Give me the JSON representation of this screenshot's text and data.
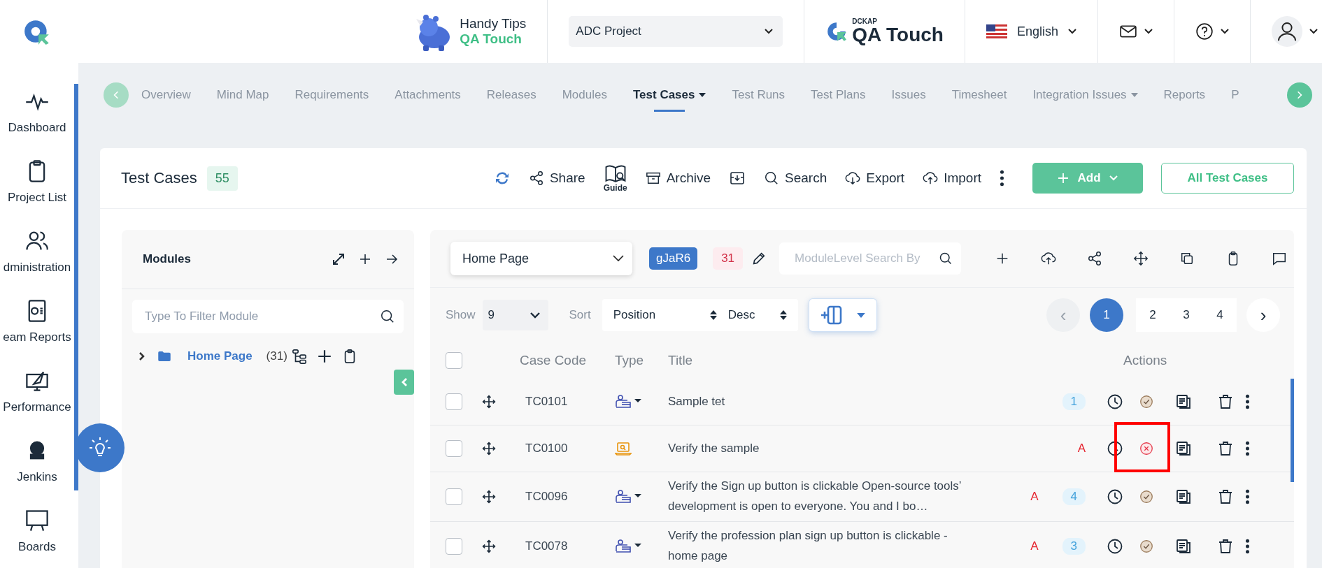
{
  "header": {
    "mascot_title": "Handy Tips",
    "mascot_subtitle": "QA Touch",
    "project": "ADC Project",
    "brand_small": "DCKAP",
    "brand": "QA Touch",
    "language": "English"
  },
  "sidebar": {
    "items": [
      {
        "label": "Dashboard"
      },
      {
        "label": "Project List"
      },
      {
        "label": "dministration"
      },
      {
        "label": "eam Reports"
      },
      {
        "label": "Performance"
      },
      {
        "label": "Jenkins"
      },
      {
        "label": "Boards"
      }
    ]
  },
  "nav_tabs": [
    {
      "label": "Overview",
      "selected": false,
      "dropdown": false
    },
    {
      "label": "Mind Map",
      "selected": false,
      "dropdown": false
    },
    {
      "label": "Requirements",
      "selected": false,
      "dropdown": false
    },
    {
      "label": "Attachments",
      "selected": false,
      "dropdown": false
    },
    {
      "label": "Releases",
      "selected": false,
      "dropdown": false
    },
    {
      "label": "Modules",
      "selected": false,
      "dropdown": false
    },
    {
      "label": "Test Cases",
      "selected": true,
      "dropdown": true
    },
    {
      "label": "Test Runs",
      "selected": false,
      "dropdown": false
    },
    {
      "label": "Test Plans",
      "selected": false,
      "dropdown": false
    },
    {
      "label": "Issues",
      "selected": false,
      "dropdown": false
    },
    {
      "label": "Timesheet",
      "selected": false,
      "dropdown": false
    },
    {
      "label": "Integration Issues",
      "selected": false,
      "dropdown": true
    },
    {
      "label": "Reports",
      "selected": false,
      "dropdown": false
    },
    {
      "label": "P",
      "selected": false,
      "dropdown": false
    }
  ],
  "page": {
    "title": "Test Cases",
    "count": "55",
    "toolbar": [
      {
        "kind": "refresh"
      },
      {
        "kind": "share",
        "label": "Share"
      },
      {
        "kind": "guide",
        "label": "Guide"
      },
      {
        "kind": "archive",
        "label": "Archive"
      },
      {
        "kind": "tray"
      },
      {
        "kind": "search",
        "label": "Search"
      },
      {
        "kind": "export",
        "label": "Export"
      },
      {
        "kind": "import",
        "label": "Import"
      },
      {
        "kind": "more"
      }
    ],
    "add_button": "Add",
    "all_button": "All Test Cases"
  },
  "modules": {
    "title": "Modules",
    "filter_placeholder": "Type To Filter Module",
    "tree": [
      {
        "label": "Home Page",
        "count": "(31)",
        "expanded": false
      }
    ]
  },
  "cases": {
    "module": "Home Page",
    "module_code": "gJaR6",
    "module_count": "31",
    "search_placeholder": "ModuleLevel Search By",
    "show_label": "Show",
    "show_value": "9",
    "sort_label": "Sort",
    "sort_field": "Position",
    "sort_order": "Desc",
    "pages": [
      {
        "label": "1",
        "selected": true
      },
      {
        "label": "2",
        "selected": false
      },
      {
        "label": "3",
        "selected": false
      },
      {
        "label": "4",
        "selected": false
      }
    ],
    "prev": "‹",
    "next": "›",
    "columns": [
      "Case Code",
      "Type",
      "Title",
      "Actions"
    ],
    "all_checked": false,
    "rows": [
      {
        "checked": false,
        "code": "TC0101",
        "kind": "manual",
        "title": "Sample tet",
        "count": "1",
        "failed": false,
        "highlighted": false
      },
      {
        "checked": false,
        "code": "TC0100",
        "kind": "automated",
        "title": "Verify the sample",
        "automation": "A",
        "failed": true,
        "highlighted": true
      },
      {
        "checked": false,
        "code": "TC0096",
        "kind": "manual",
        "title": "Verify the Sign up button is clickable Open-source tools’ development is open to everyone. You and I bo…",
        "automation": "A",
        "count": "4",
        "failed": false,
        "highlighted": false
      },
      {
        "checked": false,
        "code": "TC0078",
        "kind": "manual",
        "title": "Verify the profession plan sign up button is clickable - home page",
        "automation": "A",
        "count": "3",
        "failed": false,
        "highlighted": false
      }
    ]
  }
}
